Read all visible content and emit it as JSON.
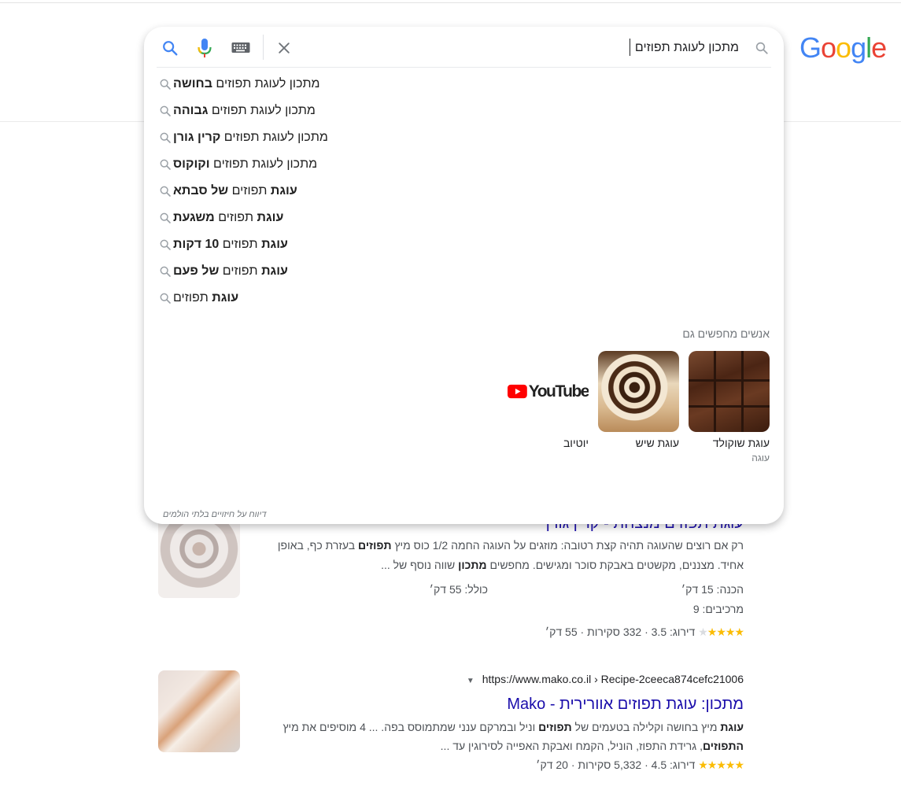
{
  "logo": {
    "letters": [
      "G",
      "o",
      "o",
      "g",
      "l",
      "e"
    ],
    "colors": [
      "#4285f4",
      "#ea4335",
      "#fbbc05",
      "#4285f4",
      "#34a853",
      "#ea4335"
    ]
  },
  "search": {
    "value": "מתכון לעוגת תפוזים",
    "placeholder": ""
  },
  "icons": {
    "search": "search-icon",
    "mic": "mic-icon",
    "keyboard": "keyboard-icon",
    "clear": "close-icon"
  },
  "suggestions": [
    {
      "plain": "מתכון לעוגת תפוזים",
      "bold": "בחושה",
      "bold_first": false
    },
    {
      "plain": "מתכון לעוגת תפוזים",
      "bold": "גבוהה",
      "bold_first": false
    },
    {
      "plain": "מתכון לעוגת תפוזים",
      "bold": "קרין גורן",
      "bold_first": false
    },
    {
      "plain": "מתכון לעוגת תפוזים",
      "bold": "וקוקוס",
      "bold_first": false
    },
    {
      "pre": "עוגת",
      "plain": "תפוזים",
      "bold": "של סבתא"
    },
    {
      "pre": "עוגת",
      "plain": "תפוזים",
      "bold": "משגעת"
    },
    {
      "pre": "עוגת",
      "plain": "תפוזים",
      "bold": "10 דקות"
    },
    {
      "pre": "עוגת",
      "plain": "תפוזים",
      "bold": "של פעם"
    },
    {
      "pre": "עוגת",
      "plain": "תפוזים",
      "bold": ""
    }
  ],
  "people_also_search": {
    "title": "אנשים מחפשים גם",
    "cards": [
      {
        "label": "עוגת שוקולד",
        "sub": "עוגה"
      },
      {
        "label": "עוגת שיש",
        "sub": ""
      },
      {
        "label": "יוטיוב",
        "sub": "",
        "logo_text": "YouTube"
      }
    ]
  },
  "report_link": "דיווח על חיזויים בלתי הולמים",
  "results": [
    {
      "title": "עוגת תפוזים מנצחת - קרין גורן",
      "snippet_parts": [
        {
          "t": "רק אם רוצים שהעוגה תהיה קצת רטובה: מוזגים על העוגה החמה 1/2 כוס מיץ ",
          "b": false
        },
        {
          "t": "תפוזים",
          "b": true
        },
        {
          "t": " בעזרת כף, באופן אחיד. מצננים, מקשטים באבקת סוכר ומגישים. מחפשים ",
          "b": false
        },
        {
          "t": "מתכון",
          "b": true
        },
        {
          "t": " שווה נוסף של ...",
          "b": false
        }
      ],
      "prep": "הכנה: 15 דק׳",
      "total": "כולל: 55 דק׳",
      "ingredients": "מרכיבים: 9",
      "rating_text": "דירוג: 3.5 · 332 סקירות · 55 דק׳",
      "rating": 3.5
    },
    {
      "url": "https://www.mako.co.il › Recipe-2ceeca874cefc21006",
      "title": "מתכון: עוגת תפוזים אוורירית - Mako",
      "snippet_parts": [
        {
          "t": "עוגת",
          "b": true
        },
        {
          "t": " מיץ בחושה וקלילה בטעמים של ",
          "b": false
        },
        {
          "t": "תפוזים",
          "b": true
        },
        {
          "t": " וניל ובמרקם ענני שמתמוסס בפה. ... 4 מוסיפים את מיץ ",
          "b": false
        },
        {
          "t": "התפוזים",
          "b": true
        },
        {
          "t": ", גרידת התפוז, הוניל, הקמח ואבקת האפייה לסירוגין עד ...",
          "b": false
        }
      ],
      "rating_text": "דירוג: 4.5 · 5,332 סקירות · 20 דק׳",
      "rating": 4.5
    }
  ]
}
